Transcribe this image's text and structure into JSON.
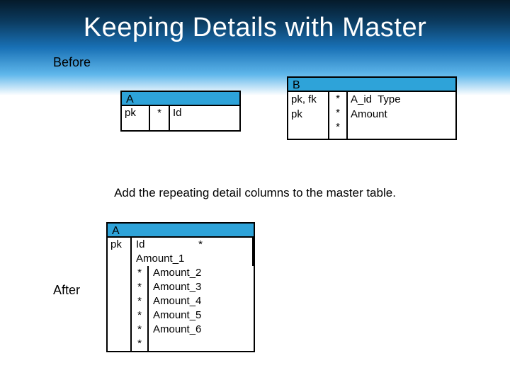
{
  "title": "Keeping Details with Master",
  "labels": {
    "before": "Before",
    "after": "After"
  },
  "caption": "Add the repeating detail columns to the master table.",
  "before": {
    "A": {
      "name": "A",
      "key": "pk",
      "star": "*",
      "attrs": "Id"
    },
    "B": {
      "name": "B",
      "keys": "pk, fk\npk",
      "stars": [
        "*",
        "*",
        "*"
      ],
      "attrs": "A_id  Type\nAmount"
    }
  },
  "after": {
    "A": {
      "name": "A",
      "key": "pk",
      "rows": [
        {
          "star": "*",
          "attr": "Id\nAmount_1"
        },
        {
          "star": "*",
          "attr": "Amount_2"
        },
        {
          "star": "*",
          "attr": "Amount_3"
        },
        {
          "star": "*",
          "attr": "Amount_4"
        },
        {
          "star": "*",
          "attr": "Amount_5"
        },
        {
          "star": "*",
          "attr": "Amount_6"
        },
        {
          "star": "*",
          "attr": ""
        }
      ]
    }
  }
}
